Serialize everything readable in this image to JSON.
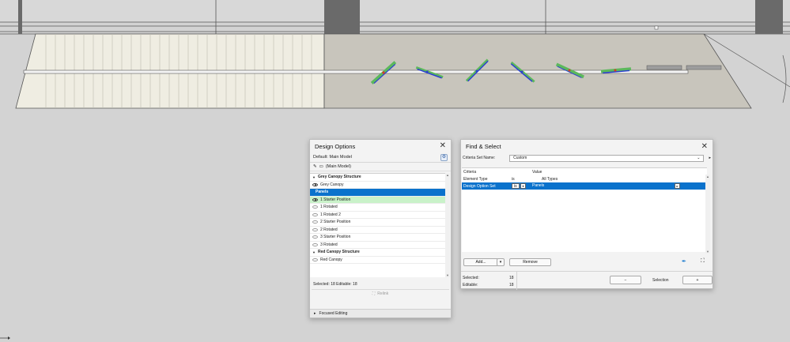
{
  "design_options": {
    "title": "Design Options",
    "default_label": "Default: Main Model",
    "main_model_label": "(Main Model)",
    "rows": [
      {
        "label": "Grey Canopy Structure",
        "kind": "group"
      },
      {
        "label": "Grey Canopy",
        "kind": "item",
        "eye": "on"
      },
      {
        "label": "Panels",
        "kind": "selected"
      },
      {
        "label": "1 Starter Position",
        "kind": "active",
        "eye": "on"
      },
      {
        "label": "1 Rotated",
        "kind": "item",
        "eye": "off"
      },
      {
        "label": "1 Rotated 2",
        "kind": "item",
        "eye": "off"
      },
      {
        "label": "2 Starter Position",
        "kind": "item",
        "eye": "off"
      },
      {
        "label": "2 Rotated",
        "kind": "item",
        "eye": "off"
      },
      {
        "label": "3 Starter Position",
        "kind": "item",
        "eye": "off"
      },
      {
        "label": "3 Rotated",
        "kind": "item",
        "eye": "off"
      },
      {
        "label": "Red Canopy Structure",
        "kind": "group"
      },
      {
        "label": "Red Canopy",
        "kind": "item",
        "eye": "off"
      }
    ],
    "status": "Selected: 18 Editable: 18",
    "relink_label": "Relink",
    "focused_editing_label": "Focused Editing"
  },
  "find_select": {
    "title": "Find & Select",
    "criteria_set_label": "Criteria Set Name:",
    "criteria_set_value": "Custom",
    "columns": {
      "criteria": "Criteria",
      "value": "Value"
    },
    "rows": [
      {
        "criteria": "Element Type",
        "op": "is",
        "value": "All Types"
      },
      {
        "criteria": "Design Option Set",
        "op": "is",
        "value": "Panels"
      }
    ],
    "add_label": "Add...",
    "remove_label": "Remove",
    "selected_label": "Selected:",
    "selected_value": "18",
    "editable_label": "Editable:",
    "editable_value": "18",
    "minus_label": "−",
    "selection_label": "Selection",
    "plus_label": "+"
  },
  "colors": {
    "selection_blue": "#0a72cc",
    "active_green": "#c9f2c9",
    "panel_green": "#5cb85c",
    "panel_blue": "#2c3fd0",
    "marker_red": "#d43b2a"
  }
}
